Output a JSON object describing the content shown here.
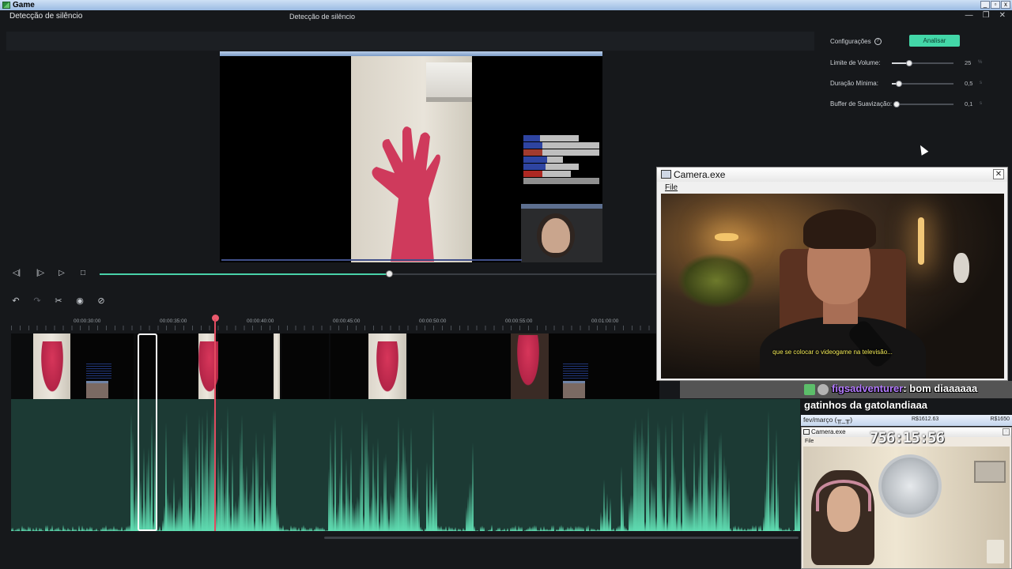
{
  "outer_window": {
    "title": "Game"
  },
  "app": {
    "left_title": "Detecção de silêncio",
    "center_title": "Detecção de silêncio",
    "window_controls": [
      "—",
      "❐",
      "✕"
    ]
  },
  "settings": {
    "label": "Configurações",
    "analyze_button": "Analisar",
    "sliders": [
      {
        "label": "Limite de Volume:",
        "value": "25",
        "unit": "%",
        "fraction": 0.28
      },
      {
        "label": "Duração Mínima:",
        "value": "0,5",
        "unit": "s",
        "fraction": 0.12
      },
      {
        "label": "Buffer de Suavização:",
        "value": "0,1",
        "unit": "s",
        "fraction": 0.03
      }
    ]
  },
  "playback": {
    "progress_fraction": 0.51
  },
  "timeline": {
    "ruler_labels": [
      "00:00:30:00",
      "00:00:35:00",
      "00:00:40:00",
      "00:00:45:00",
      "00:00:50:00",
      "00:00:55:00",
      "00:01:00:00"
    ]
  },
  "camera_window": {
    "title": "Camera.exe",
    "menu": "File",
    "subtitle": "que se colocar o videogame na televisão..."
  },
  "chat_overlay": {
    "username": "figsadventurer",
    "message": ": bom diaaaaaa",
    "message2": "gatinhos da gatolandiaaa"
  },
  "stream_bar": {
    "left": "fev/março (╥_╥)",
    "middle": "R$1612.63",
    "right": "R$1650"
  },
  "streamer_cam": {
    "title": "Camera.exe",
    "menu": "File",
    "timer": "756:15:56"
  },
  "colors": {
    "accent": "#43d7a8",
    "playhead": "#e24b60",
    "waveform": "#5fdcb1",
    "waveform_bg": "#1c3a34"
  }
}
